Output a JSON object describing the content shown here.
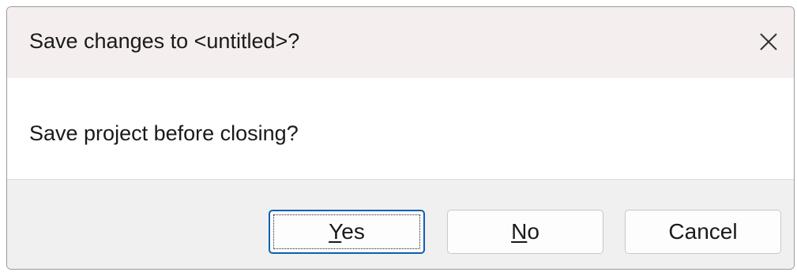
{
  "dialog": {
    "title": "Save changes to <untitled>?",
    "message": "Save project before closing?",
    "close_icon": "close-icon",
    "buttons": {
      "yes": {
        "accel": "Y",
        "rest": "es",
        "default": true
      },
      "no": {
        "accel": "N",
        "rest": "o"
      },
      "cancel": {
        "label": "Cancel"
      }
    }
  },
  "colors": {
    "title_bar": "#f4efee",
    "footer": "#f0f0f0",
    "default_button_border": "#0a5fb4"
  }
}
